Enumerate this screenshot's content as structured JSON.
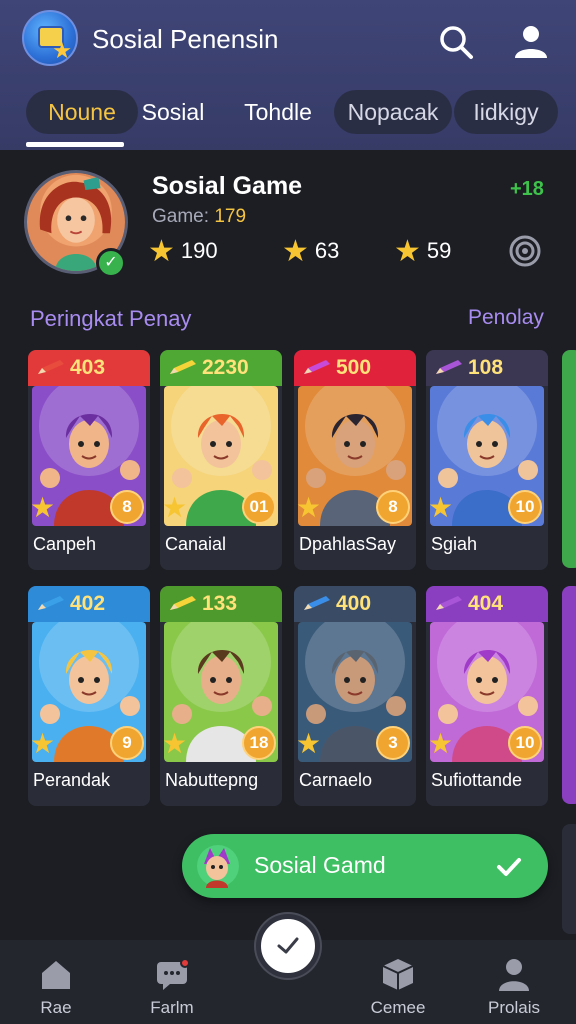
{
  "header": {
    "title": "Sosial Penensin",
    "tabs": [
      {
        "label": "Noune",
        "state": "active"
      },
      {
        "label": "Sosial",
        "state": "plain"
      },
      {
        "label": "Tohdle",
        "state": "plain"
      },
      {
        "label": "Nopacak",
        "state": "pill"
      },
      {
        "label": "Iidkigy",
        "state": "pill"
      }
    ]
  },
  "profile": {
    "name": "Sosial Game",
    "game_label": "Game:",
    "game_value": "179",
    "delta": "+18",
    "stats": [
      "190",
      "63",
      "59"
    ]
  },
  "section": {
    "title": "Peringkat Penay",
    "link": "Penolay"
  },
  "cards": [
    {
      "score": "403",
      "name": "Canpeh",
      "level": "8",
      "theme": "#e23a3a",
      "pencil": "#e84c3d"
    },
    {
      "score": "2230",
      "name": "Canaial",
      "level": "01",
      "theme": "#4fa833",
      "pencil": "#f5d43a"
    },
    {
      "score": "500",
      "name": "DpahlasSay",
      "level": "8",
      "theme": "#e0233b",
      "pencil": "#c74ad8"
    },
    {
      "score": "108",
      "name": "Sgiah",
      "level": "10",
      "theme": "#3b3752",
      "pencil": "#a855d8"
    },
    {
      "score": "402",
      "name": "Perandak",
      "level": "9",
      "theme": "#2d8bd8",
      "pencil": "#3aa0e8"
    },
    {
      "score": "133",
      "name": "Nabuttepng",
      "level": "18",
      "theme": "#4f9a2c",
      "pencil": "#f5d43a"
    },
    {
      "score": "400",
      "name": "Carnaelo",
      "level": "3",
      "theme": "#3a4b66",
      "pencil": "#3a8ee8"
    },
    {
      "score": "404",
      "name": "Sufiottande",
      "level": "10",
      "theme": "#8a3fc0",
      "pencil": "#a855d8"
    }
  ],
  "toast": {
    "label": "Sosial Gamd"
  },
  "bottom_nav": [
    {
      "label": "Rae",
      "icon": "home-icon"
    },
    {
      "label": "Farlm",
      "icon": "chat-icon"
    },
    {
      "label": "Cemee",
      "icon": "cube-icon"
    },
    {
      "label": "Prolais",
      "icon": "profile-icon"
    }
  ]
}
